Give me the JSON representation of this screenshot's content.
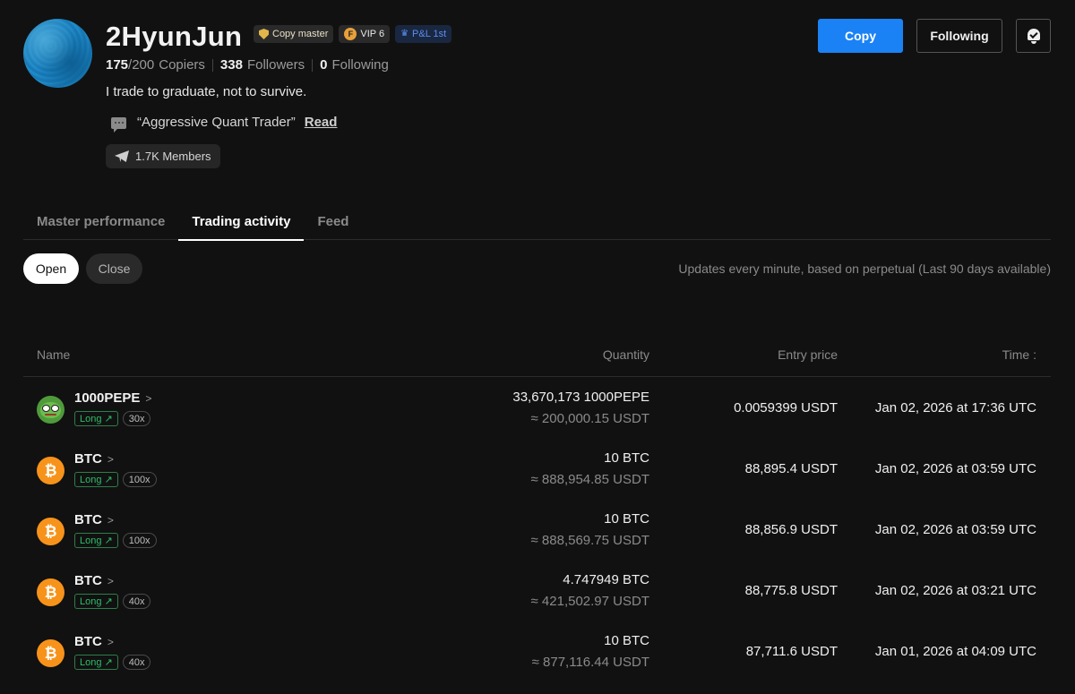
{
  "profile": {
    "name": "2HyunJun",
    "badges": {
      "copy_master": "Copy master",
      "vip": "VIP 6",
      "vip_icon_letter": "F",
      "pnl": "P&L 1st"
    },
    "copiers_current": "175",
    "copiers_max": "/200",
    "copiers_label": "Copiers",
    "followers_count": "338",
    "followers_label": "Followers",
    "following_count": "0",
    "following_label": "Following",
    "bio": "I trade to graduate, not to survive.",
    "quote": "“Aggressive Quant Trader”",
    "read_label": "Read",
    "members": "1.7K Members"
  },
  "actions": {
    "copy_label": "Copy",
    "following_label": "Following"
  },
  "tabs": [
    {
      "label": "Master performance",
      "active": false
    },
    {
      "label": "Trading activity",
      "active": true
    },
    {
      "label": "Feed",
      "active": false
    }
  ],
  "filters": {
    "open_label": "Open",
    "close_label": "Close",
    "note": "Updates every minute, based on perpetual (Last 90 days available)"
  },
  "table": {
    "headers": {
      "name": "Name",
      "quantity": "Quantity",
      "entry_price": "Entry price",
      "time": "Time :"
    },
    "rows": [
      {
        "icon": "pepe-icon",
        "symbol": "1000PEPE",
        "side": "Long",
        "leverage": "30x",
        "quantity": "33,670,173 1000PEPE",
        "value": "≈ 200,000.15 USDT",
        "entry_price": "0.0059399 USDT",
        "time": "Jan 02, 2026 at 17:36 UTC"
      },
      {
        "icon": "btc-icon",
        "symbol": "BTC",
        "side": "Long",
        "leverage": "100x",
        "quantity": "10 BTC",
        "value": "≈ 888,954.85 USDT",
        "entry_price": "88,895.4 USDT",
        "time": "Jan 02, 2026 at 03:59 UTC"
      },
      {
        "icon": "btc-icon",
        "symbol": "BTC",
        "side": "Long",
        "leverage": "100x",
        "quantity": "10 BTC",
        "value": "≈ 888,569.75 USDT",
        "entry_price": "88,856.9 USDT",
        "time": "Jan 02, 2026 at 03:59 UTC"
      },
      {
        "icon": "btc-icon",
        "symbol": "BTC",
        "side": "Long",
        "leverage": "40x",
        "quantity": "4.747949 BTC",
        "value": "≈ 421,502.97 USDT",
        "entry_price": "88,775.8 USDT",
        "time": "Jan 02, 2026 at 03:21 UTC"
      },
      {
        "icon": "btc-icon",
        "symbol": "BTC",
        "side": "Long",
        "leverage": "40x",
        "quantity": "10 BTC",
        "value": "≈ 877,116.44 USDT",
        "entry_price": "87,711.6 USDT",
        "time": "Jan 01, 2026 at 04:09 UTC"
      }
    ]
  },
  "colors": {
    "background": "#111111",
    "accent": "#1a82f5",
    "long_green": "#2ebd68",
    "btc_orange": "#f7931a"
  }
}
